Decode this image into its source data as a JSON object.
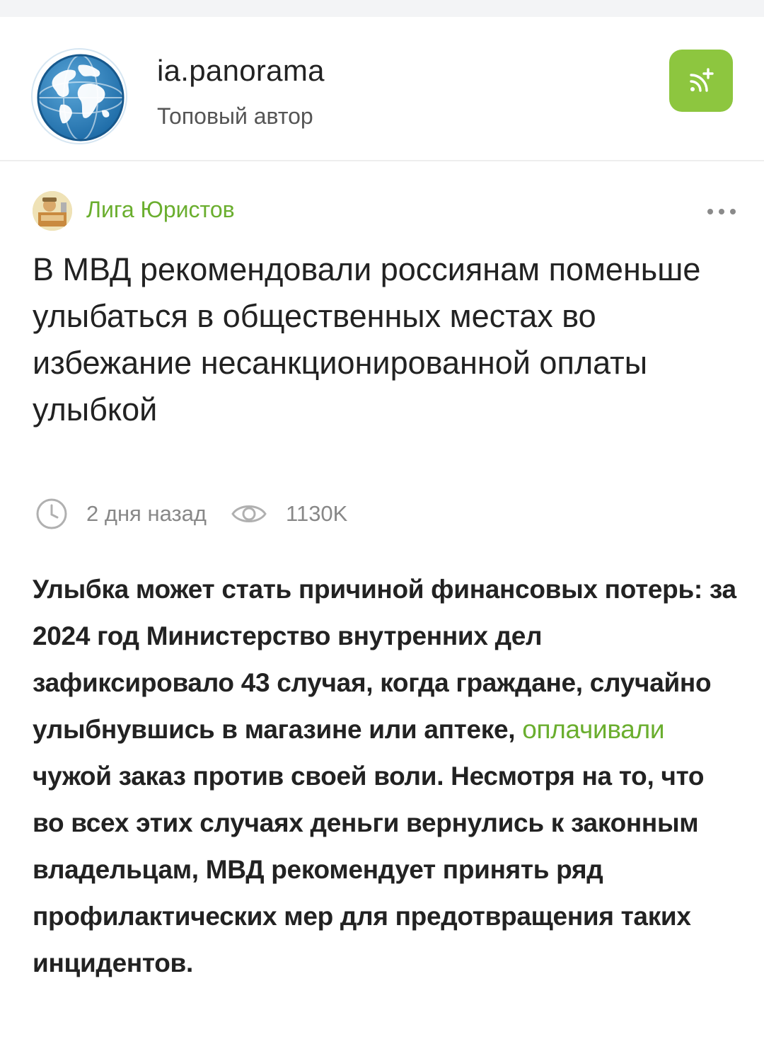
{
  "author": {
    "name": "ia.panorama",
    "status": "Топовый автор"
  },
  "post": {
    "community": "Лига Юристов",
    "title": "В МВД рекомендовали россиянам поменьше улыбаться в общественных местах во избежание несанкционированной оплаты улыбкой",
    "time_ago": "2 дня назад",
    "views": "1130K",
    "body": {
      "part1": "Улыбка может стать причиной финансовых потерь: за 2024 год Министерство внутренних дел зафиксировало 43 случая, когда граждане, случайно улыбнувшись в магазине или аптеке, ",
      "link": "оплачивали",
      "part2": " чужой заказ против своей воли. Несмотря на то, что во всех этих случаях деньги вернулись к законным владельцам, МВД рекомендует принять ряд профилактических мер для предотвращения таких инцидентов."
    }
  },
  "icons": {
    "avatar": "globe-icon",
    "subscribe": "subscribe-plus-icon",
    "community": "community-avatar",
    "more": "more-dots-icon",
    "time": "clock-icon",
    "views": "eye-icon"
  },
  "colors": {
    "accent": "#8dc63f",
    "link": "#6aae2e",
    "text": "#222222",
    "muted": "#888888"
  }
}
